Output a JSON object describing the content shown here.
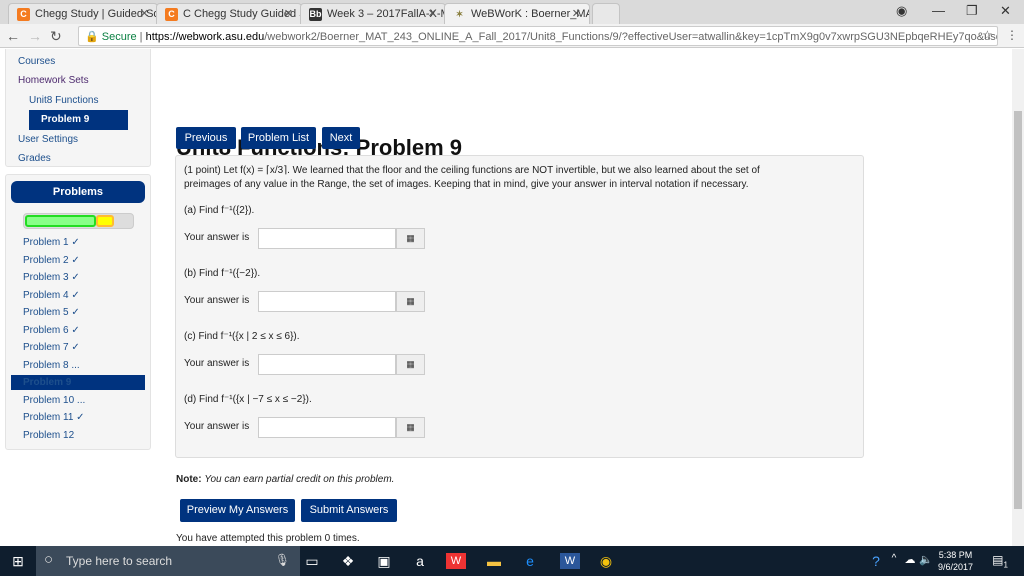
{
  "browser": {
    "tabs": [
      {
        "label": "Chegg Study | Guided So",
        "icon": "chegg-icon"
      },
      {
        "label": "C Chegg Study Guided S",
        "icon": "chegg-icon"
      },
      {
        "label": "Week 3 – 2017FallA-X-M",
        "icon": "blackboard-icon"
      },
      {
        "label": "WeBWorK : Boerner_MAT",
        "icon": "webwork-icon"
      }
    ],
    "secure": "Secure",
    "url_host": "https://webwork.asu.edu",
    "url_path": "/webwork2/Boerner_MAT_243_ONLINE_A_Fall_2017/Unit8_Functions/9/?effectiveUser=atwallin&key=1cpTmX9g0v7xwrpSGU3NEpbqeRHEy7qo&user=atwal..."
  },
  "nav": {
    "courses": "Courses",
    "homework_sets": "Homework Sets",
    "unit": "Unit8 Functions",
    "problem": "Problem 9",
    "user_settings": "User Settings",
    "grades": "Grades"
  },
  "problems_panel": {
    "title": "Problems",
    "progress": {
      "correct_fraction": 0.667,
      "partial_fraction": 0.167,
      "colors": {
        "correct": "#88ff88",
        "partial": "#ffff00"
      }
    },
    "items": [
      "Problem 1 ✓",
      "Problem 2 ✓",
      "Problem 3 ✓",
      "Problem 4 ✓",
      "Problem 5 ✓",
      "Problem 6 ✓",
      "Problem 7 ✓",
      "Problem 8 ...",
      "Problem 9",
      "Problem 10 ...",
      "Problem 11 ✓",
      "Problem 12"
    ],
    "selected": "Problem 9"
  },
  "main": {
    "title": "Unit8 Functions: Problem 9",
    "buttons": {
      "previous": "Previous",
      "problem_list": "Problem List",
      "next": "Next"
    },
    "intro_1": "(1 point) Let f(x) = ⌈x/3⌉. We learned that the floor and the ceiling functions are NOT invertible, but we also learned about the set of",
    "intro_2": "preimages of any value in the Range, the set of images. Keeping that in mind, give your answer in interval notation if necessary.",
    "parts": [
      {
        "q": "(a) Find f⁻¹({2}).",
        "answer": ""
      },
      {
        "q": "(b) Find f⁻¹({−2}).",
        "answer": ""
      },
      {
        "q": "(c) Find f⁻¹({x | 2 ≤ x ≤ 6}).",
        "answer": ""
      },
      {
        "q": "(d) Find f⁻¹({x | −7 ≤ x ≤ −2}).",
        "answer": ""
      }
    ],
    "answer_label": "Your answer is",
    "note_label": "Note:",
    "note_text": "You can earn partial credit on this problem.",
    "preview": "Preview My Answers",
    "submit": "Submit Answers",
    "attempts": "You have attempted this problem 0 times."
  },
  "taskbar": {
    "search_placeholder": "Type here to search",
    "time": "5:38 PM",
    "date": "9/6/2017",
    "notifications": "1"
  }
}
